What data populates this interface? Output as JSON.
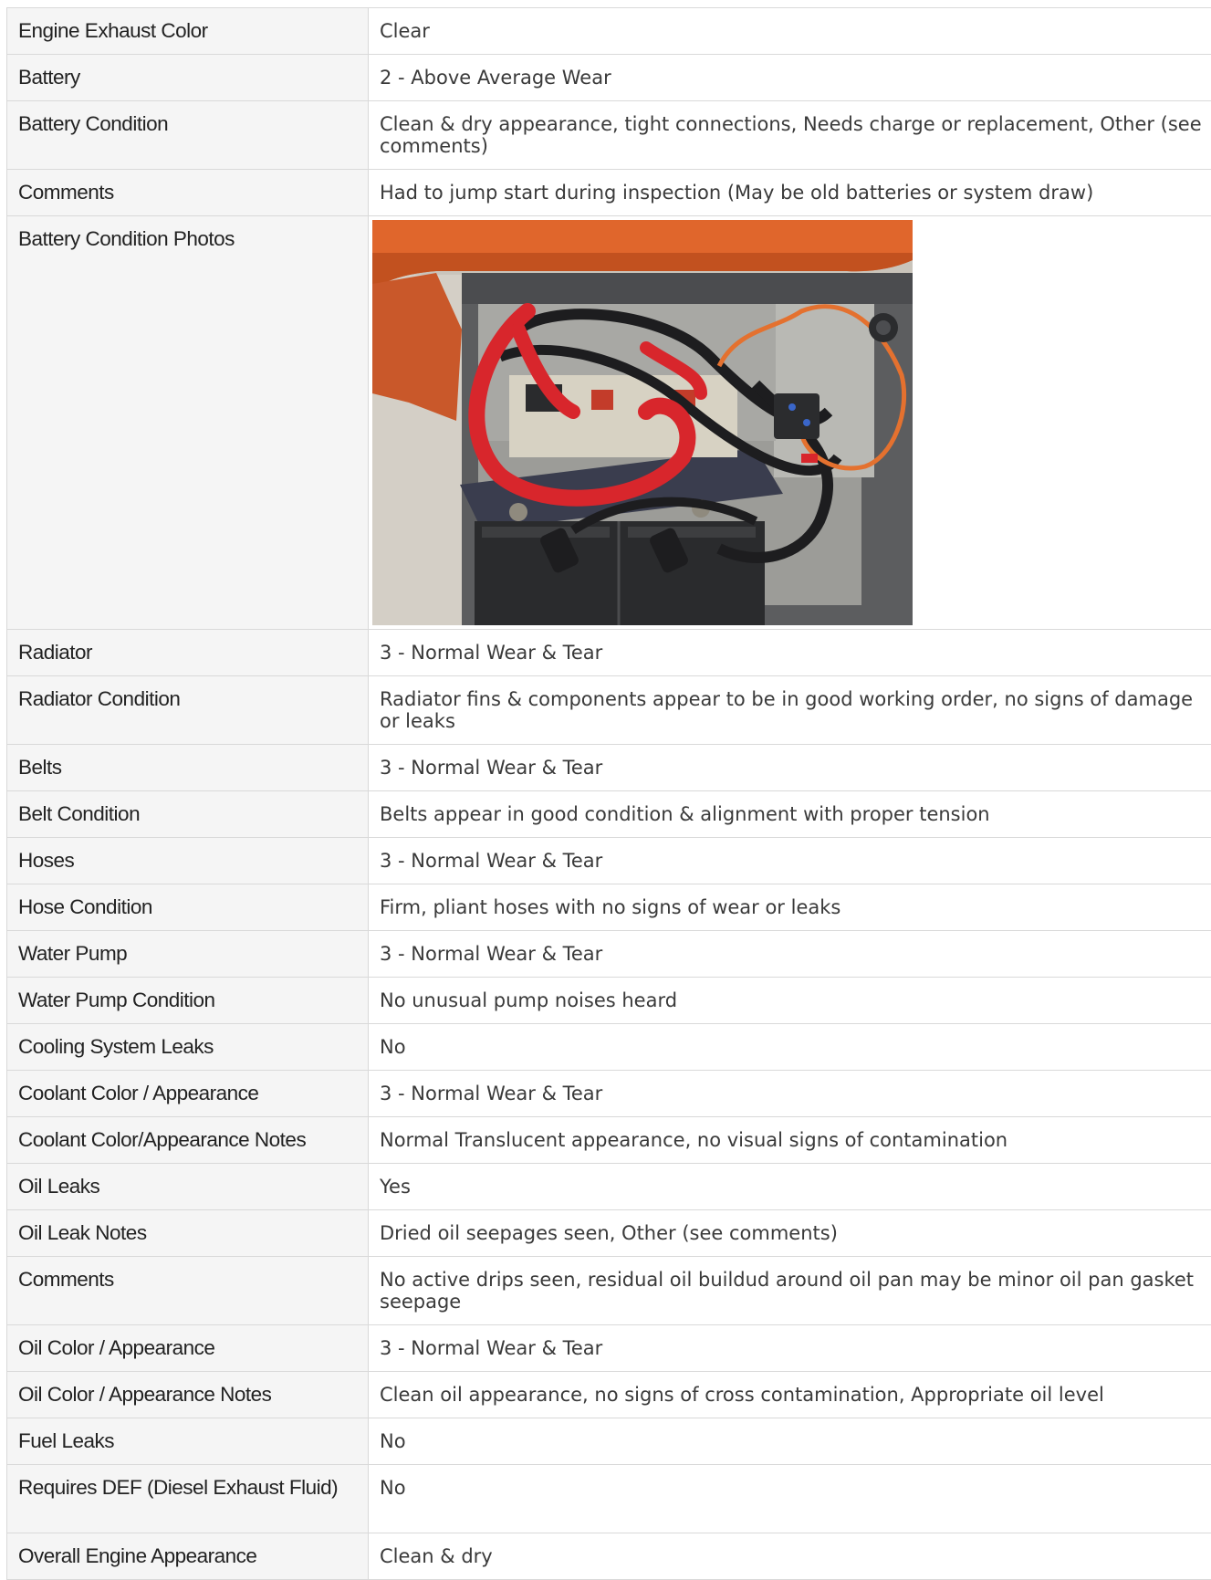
{
  "rows": [
    {
      "label": "Engine Exhaust Color",
      "value": "Clear"
    },
    {
      "label": "Battery",
      "value": "2 - Above Average Wear"
    },
    {
      "label": "Battery Condition",
      "value": "Clean & dry appearance, tight connections, Needs charge or replacement, Other (see comments)"
    },
    {
      "label": "Comments",
      "value": "Had to jump start during inspection (May be old batteries or system draw)"
    },
    {
      "label": "Battery Condition Photos",
      "value": ""
    },
    {
      "label": "Radiator",
      "value": "3 - Normal Wear & Tear"
    },
    {
      "label": "Radiator Condition",
      "value": "Radiator fins & components appear to be in good working order, no signs of damage or leaks"
    },
    {
      "label": "Belts",
      "value": "3 - Normal Wear & Tear"
    },
    {
      "label": "Belt Condition",
      "value": "Belts appear in good condition & alignment with proper tension"
    },
    {
      "label": "Hoses",
      "value": "3 - Normal Wear & Tear"
    },
    {
      "label": "Hose Condition",
      "value": "Firm, pliant hoses with no signs of wear or leaks"
    },
    {
      "label": "Water Pump",
      "value": "3 - Normal Wear & Tear"
    },
    {
      "label": "Water Pump Condition",
      "value": "No unusual pump noises heard"
    },
    {
      "label": "Cooling System Leaks",
      "value": "No"
    },
    {
      "label": "Coolant Color / Appearance",
      "value": "3 - Normal Wear & Tear"
    },
    {
      "label": "Coolant Color/Appearance Notes",
      "value": "Normal Translucent appearance, no visual signs of contamination"
    },
    {
      "label": "Oil Leaks",
      "value": "Yes"
    },
    {
      "label": "Oil Leak Notes",
      "value": "Dried oil seepages seen, Other (see comments)"
    },
    {
      "label": "Comments",
      "value": "No active drips seen, residual oil buildud around oil pan may be minor oil pan gasket seepage"
    },
    {
      "label": "Oil Color / Appearance",
      "value": "3 - Normal Wear & Tear"
    },
    {
      "label": "Oil Color / Appearance Notes",
      "value": "Clean oil appearance, no signs of cross contamination, Appropriate oil level"
    },
    {
      "label": "Fuel Leaks",
      "value": "No"
    },
    {
      "label": "Requires DEF (Diesel Exhaust Fluid)",
      "value": "No"
    },
    {
      "label": "Overall Engine Appearance",
      "value": "Clean & dry"
    }
  ],
  "photo": {
    "subject": "battery-compartment-photo",
    "colors": {
      "tank": "#e0662c",
      "frame": "#5c5d5f",
      "panel": "#b9b9b4",
      "cable_red": "#d8262c",
      "cable_black": "#1d1d1f",
      "cable_orange": "#e4712f",
      "battery": "#2a2b2d",
      "ground": "#c9c4bb"
    }
  }
}
